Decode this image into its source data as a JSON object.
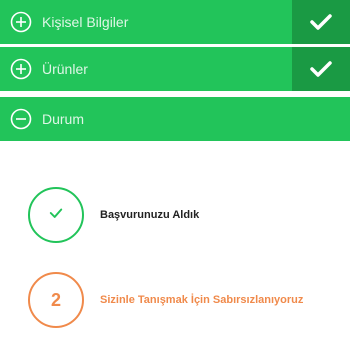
{
  "accordion": {
    "items": [
      {
        "label": "Kişisel Bilgiler",
        "icon": "plus-circle-icon",
        "completed": true
      },
      {
        "label": "Ürünler",
        "icon": "plus-circle-icon",
        "completed": true
      },
      {
        "label": "Durum",
        "icon": "minus-circle-icon",
        "completed": false
      }
    ]
  },
  "status": {
    "steps": [
      {
        "indicator": "check-icon",
        "text": "Başvurunuzu Aldık",
        "state": "done"
      },
      {
        "indicator": "2",
        "text": "Sizinle Tanışmak İçin Sabırsızlanıyoruz",
        "state": "current"
      }
    ]
  },
  "colors": {
    "green": "#22c45a",
    "dark_green": "#1a9a44",
    "orange": "#f08a4b",
    "text_dark": "#222222"
  }
}
